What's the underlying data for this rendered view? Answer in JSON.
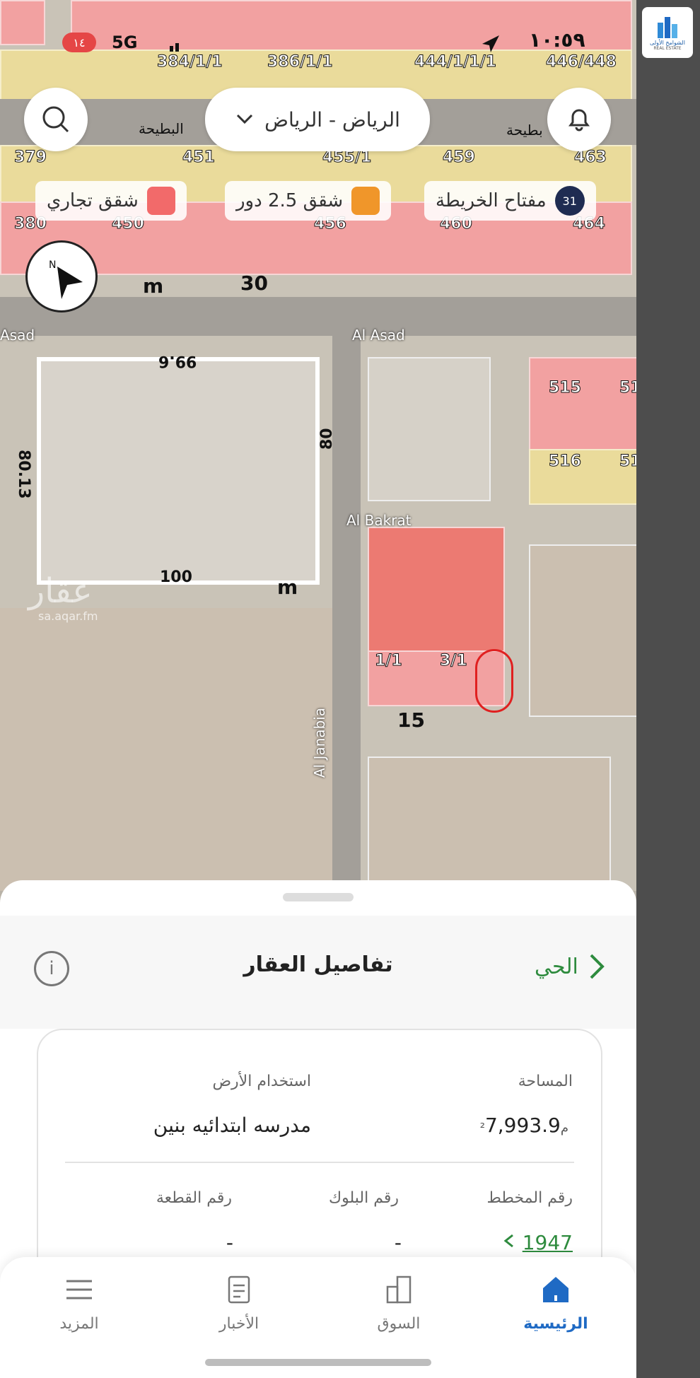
{
  "status_bar": {
    "time": "١٠:٥٩",
    "network": "5G",
    "battery": "١٤"
  },
  "city_selector": {
    "label": "الرياض - الرياض"
  },
  "legend": {
    "key_label": "مفتاح الخريطة",
    "key_count": "31",
    "items": [
      {
        "label": "شقق 2.5 دور",
        "color": "#f0962a"
      },
      {
        "label": "شقق تجاري",
        "color": "#f26a6a"
      }
    ]
  },
  "map": {
    "plot_numbers_top": [
      "384/1/1",
      "386/1/1",
      "444/1/1/1",
      "446/448"
    ],
    "plot_numbers_mid": [
      "379",
      "451",
      "455/1",
      "459",
      "463"
    ],
    "plot_numbers_low": [
      "380",
      "450",
      "456",
      "460",
      "464"
    ],
    "plot_numbers_right": [
      "515",
      "51",
      "516",
      "51"
    ],
    "plot_numbers_small": [
      "1/1",
      "3/1"
    ],
    "district_labels": [
      "البطيحة",
      "بطيحة"
    ],
    "road_names": [
      "Asad",
      "Al Asad",
      "Al Bakrat",
      "Al Janabia"
    ],
    "dimensions": [
      "30",
      "m",
      "99.6",
      "80.13",
      "80",
      "100",
      "m",
      "15"
    ],
    "watermark": "عقار",
    "watermark_url": "sa.aqar.fm"
  },
  "sheet": {
    "title": "تفاصيل العقار",
    "district_link": "الحي",
    "area_label": "المساحة",
    "area_value": "7,993.9",
    "area_unit": "م²",
    "land_use_label": "استخدام الأرض",
    "land_use_value": "مدرسه ابتدائيه بنين",
    "plan_label": "رقم المخطط",
    "plan_value": "1947",
    "block_label": "رقم البلوك",
    "block_value": "-",
    "plot_label": "رقم القطعة",
    "plot_value": "-"
  },
  "nav": {
    "home": "الرئيسية",
    "market": "السوق",
    "news": "الأخبار",
    "more": "المزيد"
  },
  "brand": {
    "name": "الشوامخ الأولى",
    "sub": "REAL ESTATE"
  }
}
